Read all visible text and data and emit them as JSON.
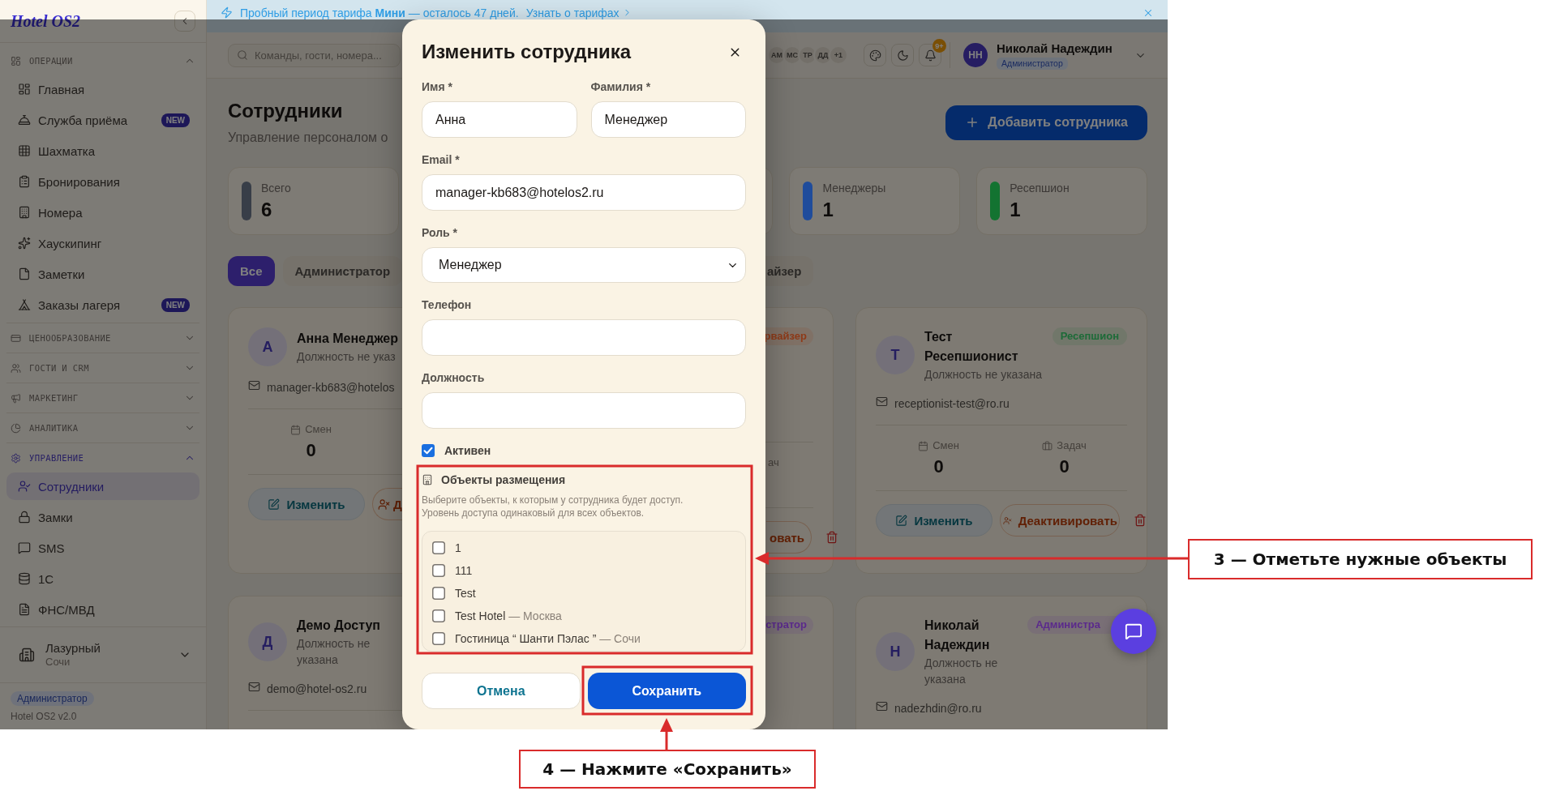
{
  "sidebar": {
    "logo": "Hotel OS2",
    "sections": [
      {
        "title": "ОПЕРАЦИИ",
        "active": false,
        "expanded": true,
        "items": [
          {
            "label": "Главная",
            "selected": false
          },
          {
            "label": "Служба приёма",
            "badge": "NEW",
            "selected": false
          },
          {
            "label": "Шахматка",
            "selected": false
          },
          {
            "label": "Бронирования",
            "selected": false
          },
          {
            "label": "Номера",
            "selected": false
          },
          {
            "label": "Хаускипинг",
            "selected": false
          },
          {
            "label": "Заметки",
            "selected": false
          },
          {
            "label": "Заказы лагеря",
            "badge": "NEW",
            "selected": false
          }
        ]
      },
      {
        "title": "ЦЕНООБРАЗОВАНИЕ",
        "active": false,
        "expanded": false
      },
      {
        "title": "ГОСТИ И CRM",
        "active": false,
        "expanded": false
      },
      {
        "title": "МАРКЕТИНГ",
        "active": false,
        "expanded": false
      },
      {
        "title": "АНАЛИТИКА",
        "active": false,
        "expanded": false
      },
      {
        "title": "УПРАВЛЕНИЕ",
        "active": true,
        "expanded": true,
        "items": [
          {
            "label": "Сотрудники",
            "selected": true
          },
          {
            "label": "Замки",
            "selected": false
          },
          {
            "label": "SMS",
            "selected": false
          },
          {
            "label": "1С",
            "selected": false
          },
          {
            "label": "ФНС/МВД",
            "selected": false
          }
        ]
      }
    ],
    "property": {
      "name": "Лазурный",
      "city": "Сочи"
    },
    "role": "Администратор",
    "version": "Hotel OS2 v2.0"
  },
  "banner": {
    "text": "Пробный период тарифа **Мини** — осталось 47 дней.",
    "link": "Узнать о тарифах"
  },
  "topbar": {
    "search": {
      "placeholder": "Команды, гости, номера..."
    },
    "presence": [
      "АМ",
      "МС",
      "ТР",
      "ДД"
    ],
    "presence_more": "+1",
    "notifications": "9+",
    "user": {
      "initials": "НН",
      "name": "Николай Надеждин",
      "role": "Администратор"
    }
  },
  "page": {
    "title": "Сотрудники",
    "subtitle": "Управление персоналом о",
    "add_button": "Добавить сотрудника"
  },
  "stats": [
    {
      "label": "Всего",
      "value": "6",
      "color": "#383e48"
    },
    {
      "label": "Менеджеры",
      "value": "1",
      "color": "#1f4c9c"
    },
    {
      "label": "Ресепшион",
      "value": "1",
      "color": "#137331"
    }
  ],
  "filters": [
    {
      "label": "Все",
      "selected": true
    },
    {
      "label": "Администратор",
      "selected": false
    },
    {
      "label": "айзер",
      "selected": false
    }
  ],
  "employees": [
    {
      "initial": "А",
      "name": "Анна Менеджер",
      "position": "Должность не указ",
      "email": "manager-kb683@hotelos",
      "shifts": {
        "label": "Смен",
        "value": "0"
      },
      "edit": "Изменить",
      "deactivate": "Д"
    },
    {
      "badge": {
        "text": "рвайзер",
        "color": "#8e3a18"
      },
      "tasks": {
        "label": "ач"
      },
      "deactivate": "овать",
      "trash": true
    },
    {
      "initial": "Т",
      "name": "Тест Ресепшионист",
      "position": "Должность не указана",
      "badge": {
        "text": "Ресепшион",
        "color": "#1d6b38"
      },
      "email": "receptionist-test@ro.ru",
      "shifts": {
        "label": "Смен",
        "value": "0"
      },
      "tasks": {
        "label": "Задач",
        "value": "0"
      },
      "edit": "Изменить",
      "deactivate": "Деактивировать",
      "trash": true
    },
    {
      "initial": "Д",
      "name": "Демо Доступ",
      "position": "Должность не указана",
      "email": "demo@hotel-os2.ru"
    },
    {
      "badge": {
        "text": "стратор",
        "color": "#5b2a8c"
      }
    },
    {
      "initial": "Н",
      "name": "Николай Надеждин",
      "position": "Должность не указана",
      "badge": {
        "text": "Администра",
        "color": "#5b2a8c"
      },
      "email": "nadezhdin@ro.ru"
    }
  ],
  "modal": {
    "title": "Изменить сотрудника",
    "fields": [
      {
        "label": "Имя *",
        "kind": "text",
        "value": "Анна"
      },
      {
        "label": "Фамилия *",
        "kind": "text",
        "value": "Менеджер"
      },
      {
        "label": "Email *",
        "kind": "text",
        "value": "manager-kb683@hotelos2.ru"
      },
      {
        "label": "Роль *",
        "kind": "select",
        "value": "Менеджер"
      },
      {
        "label": "Телефон",
        "kind": "text"
      },
      {
        "label": "Должность",
        "kind": "text"
      }
    ],
    "active": {
      "label": "Активен",
      "checked": true
    },
    "properties": {
      "title": "Объекты размещения",
      "hint": "Выберите объекты, к которым у сотрудника будет доступ. Уровень доступа одинаковый для всех объектов.",
      "items": [
        {
          "name": "1",
          "checked": false
        },
        {
          "name": "111",
          "checked": false
        },
        {
          "name": "Test",
          "checked": false
        },
        {
          "name": "Test Hotel",
          "detail": "— Москва",
          "checked": false
        },
        {
          "name": "Гостиница “ Шанти Пэлас ”",
          "detail": "— Сочи",
          "checked": false
        }
      ]
    },
    "cancel": "Отмена",
    "save": "Сохранить"
  },
  "annotations": [
    {
      "text": "3 — Отметьте нужные объекты"
    },
    {
      "text": "4 — Нажмите «Сохранить»"
    }
  ]
}
